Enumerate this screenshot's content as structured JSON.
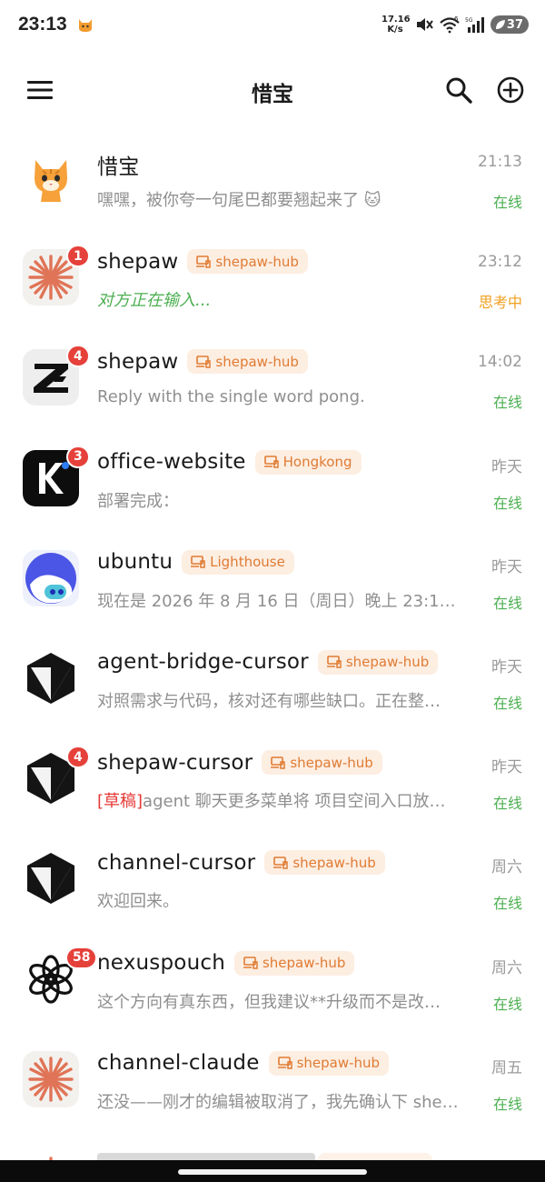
{
  "status_bar": {
    "time": "23:13",
    "net_speed_value": "17.16",
    "net_speed_unit": "K/s",
    "wifi_label": "6",
    "signal_label": "5G",
    "battery": "37"
  },
  "app_bar": {
    "title": "惜宝",
    "menu_icon": "menu-icon",
    "search_icon": "search-icon",
    "add_icon": "add-circle-icon"
  },
  "colors": {
    "online": "#4caf50",
    "thinking": "#f0a020",
    "badge": "#e5413a",
    "tag_bg": "#fdeee2",
    "tag_text": "#e07b33",
    "draft": "#e53935"
  },
  "chats": [
    {
      "name": "惜宝",
      "tag": "",
      "time": "21:13",
      "preview": "嘿嘿，被你夸一句尾巴都要翘起来了 🐱",
      "status": "在线",
      "badge": "",
      "avatar": "cat-avatar"
    },
    {
      "name": "shepaw",
      "tag": "shepaw-hub",
      "time": "23:12",
      "preview": "对方正在输入...",
      "status": "思考中",
      "badge": "1",
      "avatar": "claude-burst-avatar"
    },
    {
      "name": "shepaw",
      "tag": "shepaw-hub",
      "time": "14:02",
      "preview": "Reply with the single word pong.",
      "status": "在线",
      "badge": "4",
      "avatar": "z-logo-avatar"
    },
    {
      "name": "office-website",
      "tag": "Hongkong",
      "time": "昨天",
      "preview": "部署完成：",
      "status": "在线",
      "badge": "3",
      "avatar": "kimi-avatar"
    },
    {
      "name": "ubuntu",
      "tag": "Lighthouse",
      "time": "昨天",
      "preview": "现在是 2026 年 8 月 16 日（周日）晚上 23:1…",
      "status": "在线",
      "badge": "",
      "avatar": "cloud-robot-avatar"
    },
    {
      "name": "agent-bridge-cursor",
      "tag": "shepaw-hub",
      "time": "昨天",
      "preview": "对照需求与代码，核对还有哪些缺口。正在整…",
      "status": "在线",
      "badge": "",
      "avatar": "cursor-avatar"
    },
    {
      "name": "shepaw-cursor",
      "tag": "shepaw-hub",
      "time": "昨天",
      "draft_label": "[草稿]",
      "preview": "agent 聊天更多菜单将 项目空间入口放…",
      "status": "在线",
      "badge": "4",
      "avatar": "cursor-avatar"
    },
    {
      "name": "channel-cursor",
      "tag": "shepaw-hub",
      "time": "周六",
      "preview": "欢迎回来。",
      "status": "在线",
      "badge": "",
      "avatar": "cursor-avatar"
    },
    {
      "name": "nexuspouch",
      "tag": "shepaw-hub",
      "time": "周六",
      "preview": "这个方向有真东西，但我建议**升级而不是改…",
      "status": "在线",
      "badge": "58",
      "avatar": "openai-avatar"
    },
    {
      "name": "channel-claude",
      "tag": "shepaw-hub",
      "time": "周五",
      "preview": "还没——刚才的编辑被取消了，我先确认下 she…",
      "status": "在线",
      "badge": "",
      "avatar": "claude-burst-avatar"
    }
  ]
}
